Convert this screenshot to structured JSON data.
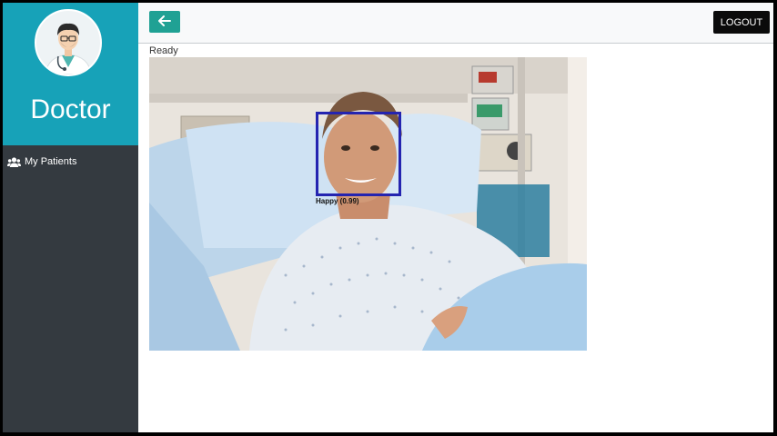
{
  "sidebar": {
    "role_title": "Doctor",
    "avatar_icon": "doctor-avatar-icon",
    "items": [
      {
        "label": "My Patients",
        "icon": "users-icon"
      }
    ]
  },
  "topbar": {
    "back_icon": "arrow-left-icon",
    "logout_label": "LOGOUT"
  },
  "main": {
    "status": "Ready",
    "detection": {
      "label": "Happy (0.99)"
    }
  },
  "colors": {
    "sidebar_header": "#17a2b8",
    "sidebar_body": "#343a40",
    "back_button": "#20a194",
    "logout_button": "#0b0b0b",
    "face_box": "#2424b0"
  }
}
